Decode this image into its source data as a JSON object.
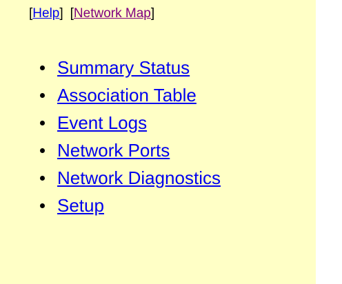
{
  "top_links": {
    "open_bracket_1": "[",
    "help": "Help",
    "close_bracket_1": "]",
    "open_bracket_2": "[",
    "network_map": "Network Map",
    "close_bracket_2": "]"
  },
  "nav": {
    "items": [
      {
        "label": "Summary Status"
      },
      {
        "label": "Association Table"
      },
      {
        "label": "Event Logs"
      },
      {
        "label": "Network Ports"
      },
      {
        "label": "Network Diagnostics"
      },
      {
        "label": "Setup"
      }
    ]
  },
  "colors": {
    "background": "#ffffc6",
    "link": "#0000ee",
    "visited_link": "#800080"
  }
}
